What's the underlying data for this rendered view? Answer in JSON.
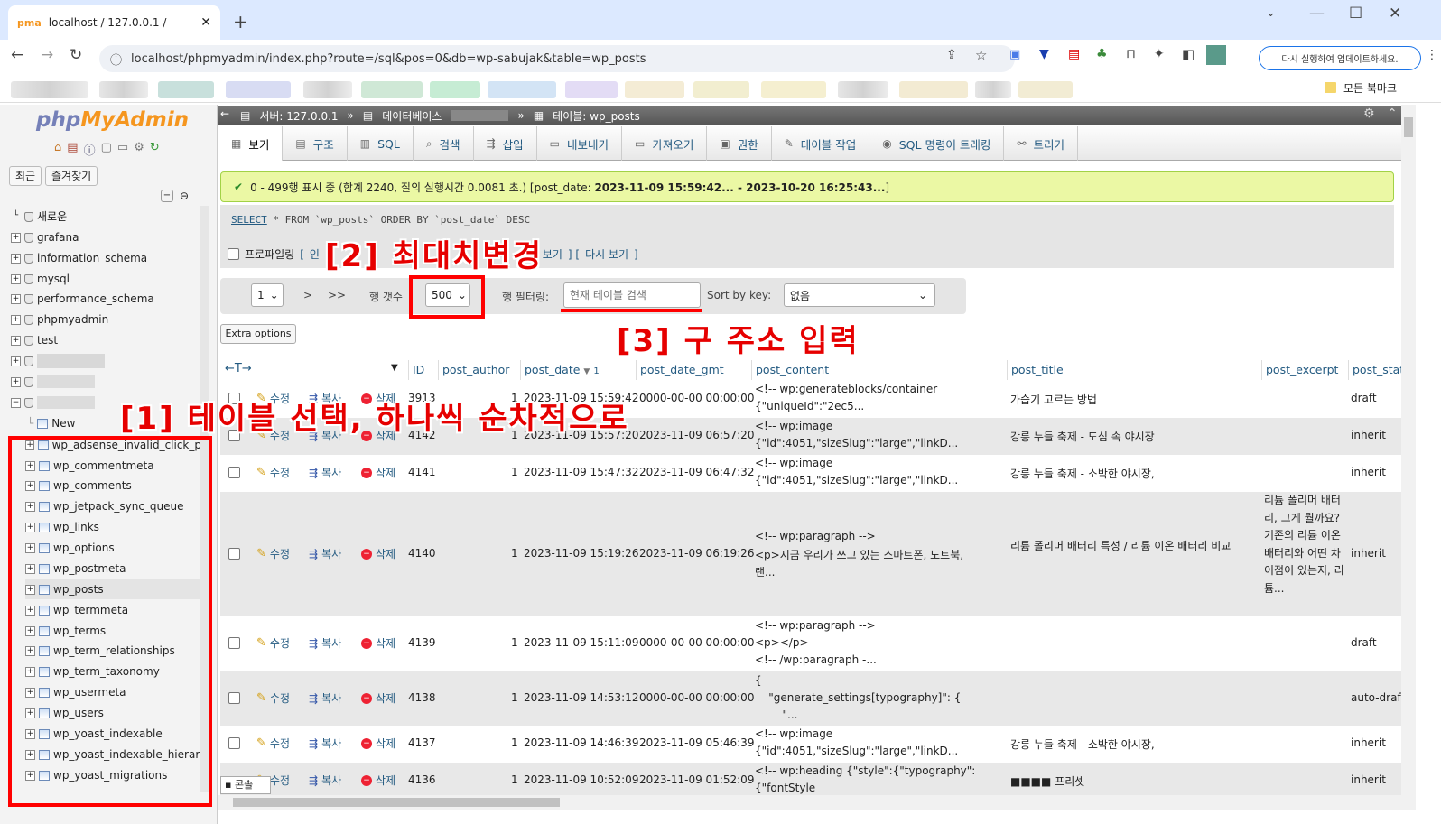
{
  "browser": {
    "tab_title": "localhost / 127.0.0.1 /",
    "url": "localhost/phpmyadmin/index.php?route=/sql&pos=0&db=wp-sabujak&table=wp_posts",
    "update_button": "다시 실행하여 업데이트하세요.",
    "bookmarks_label": "모든 북마크"
  },
  "sidebar": {
    "logo_main": "php",
    "logo_accent": "MyAdmin",
    "recent_label": "최근",
    "favorites_label": "즐겨찾기",
    "new_label": "새로운",
    "databases": [
      "grafana",
      "information_schema",
      "mysql",
      "performance_schema",
      "phpmyadmin",
      "test"
    ],
    "new_table_label": "New",
    "tables": [
      "wp_adsense_invalid_click_p",
      "wp_commentmeta",
      "wp_comments",
      "wp_jetpack_sync_queue",
      "wp_links",
      "wp_options",
      "wp_postmeta",
      "wp_posts",
      "wp_termmeta",
      "wp_terms",
      "wp_term_relationships",
      "wp_term_taxonomy",
      "wp_usermeta",
      "wp_users",
      "wp_yoast_indexable",
      "wp_yoast_indexable_hierar",
      "wp_yoast_migrations"
    ]
  },
  "breadcrumb": {
    "server": "서버: 127.0.0.1",
    "database": "데이터베이스",
    "table": "테이블: wp_posts"
  },
  "tabs": [
    "보기",
    "구조",
    "SQL",
    "검색",
    "삽입",
    "내보내기",
    "가져오기",
    "권한",
    "테이블 작업",
    "SQL 명령어 트래킹",
    "트리거"
  ],
  "success_msg": "0 - 499행 표시 중 (합계 2240, 질의 실행시간 0.0081 초.) [post_date: ",
  "success_range": "2023-11-09 15:59:42... - 2023-10-20 16:25:43...",
  "success_end": "]",
  "sql": {
    "select": "SELECT",
    "rest": "* FROM `wp_posts` ORDER BY `post_date` DESC"
  },
  "profiling": {
    "label": "프로파일링",
    "open": "[",
    "edit_fragment": "인",
    "code_fragment": "드 보기",
    "sep": "] [",
    "refresh": "다시 보기",
    "close": "]"
  },
  "nav": {
    "page": "1",
    "next": ">",
    "last": ">>",
    "rows_label": "행 갯수",
    "rows_value": "500",
    "filter_label": "행 필터링:",
    "filter_placeholder": "현재 테이블 검색",
    "sort_label": "Sort by key:",
    "sort_value": "없음"
  },
  "extra_options": "Extra options",
  "columns": {
    "arrows": "←T→",
    "id": "ID",
    "post_author": "post_author",
    "post_date": "post_date",
    "post_date_sort": "1",
    "post_date_gmt": "post_date_gmt",
    "post_content": "post_content",
    "post_title": "post_title",
    "post_excerpt": "post_excerpt",
    "post_status": "post_stat"
  },
  "row_actions": {
    "edit": "수정",
    "copy": "복사",
    "delete": "삭제"
  },
  "rows": [
    {
      "id": "3913",
      "author": "1",
      "date": "2023-11-09 15:59:42",
      "gmt": "0000-00-00 00:00:00",
      "content1": "<!-- wp:generateblocks/container",
      "content2": "{\"uniqueId\":\"2ec5...",
      "content3": "",
      "title": "가습기 고르는 방법",
      "excerpt": "",
      "status": "draft"
    },
    {
      "id": "4142",
      "author": "1",
      "date": "2023-11-09 15:57:20",
      "gmt": "2023-11-09 06:57:20",
      "content1": "<!-- wp:image",
      "content2": "{\"id\":4051,\"sizeSlug\":\"large\",\"linkD...",
      "content3": "",
      "title": "강릉 누들 축제 - 도심 속 야시장",
      "excerpt": "",
      "status": "inherit"
    },
    {
      "id": "4141",
      "author": "1",
      "date": "2023-11-09 15:47:32",
      "gmt": "2023-11-09 06:47:32",
      "content1": "<!-- wp:image",
      "content2": "{\"id\":4051,\"sizeSlug\":\"large\",\"linkD...",
      "content3": "",
      "title": "강릉 누들 축제 - 소박한 야시장,",
      "excerpt": "",
      "status": "inherit"
    },
    {
      "id": "4140",
      "author": "1",
      "date": "2023-11-09 15:19:26",
      "gmt": "2023-11-09 06:19:26",
      "content1": "<!-- wp:paragraph -->",
      "content2": "<p>지금 우리가 쓰고 있는 스마트폰, 노트북,",
      "content3": "랜...",
      "title": "리튬 폴리머 배터리 특성 / 리튬 이온 배터리 비교",
      "excerpt": "리튬 폴리머 배터리, 그게 뭘까요? 기존의 리튬 이온 배터리와 어떤 차이점이 있는지, 리튬...",
      "status": "inherit"
    },
    {
      "id": "4139",
      "author": "1",
      "date": "2023-11-09 15:11:09",
      "gmt": "0000-00-00 00:00:00",
      "content1": "<!-- wp:paragraph -->",
      "content2": "<p></p>",
      "content3": "<!-- /wp:paragraph -...",
      "title": "",
      "excerpt": "",
      "status": "draft"
    },
    {
      "id": "4138",
      "author": "1",
      "date": "2023-11-09 14:53:12",
      "gmt": "0000-00-00 00:00:00",
      "content1": "{",
      "content2": "    \"generate_settings[typography]\": {",
      "content3": "        \"...",
      "title": "",
      "excerpt": "",
      "status": "auto-draf"
    },
    {
      "id": "4137",
      "author": "1",
      "date": "2023-11-09 14:46:39",
      "gmt": "2023-11-09 05:46:39",
      "content1": "<!-- wp:image",
      "content2": "{\"id\":4051,\"sizeSlug\":\"large\",\"linkD...",
      "content3": "",
      "title": "강릉 누들 축제 - 소박한 야시장,",
      "excerpt": "",
      "status": "inherit"
    },
    {
      "id": "4136",
      "author": "1",
      "date": "2023-11-09 10:52:09",
      "gmt": "2023-11-09 01:52:09",
      "content1": "<!-- wp:heading {\"style\":{\"typography\":",
      "content2": "{\"fontStyle",
      "content3": "",
      "title": "■■■■ 프리셋",
      "excerpt": "",
      "status": "inherit"
    }
  ],
  "console_label": "콘솔",
  "annotations": {
    "a1": "[1] 테이블 선택, 하나씩 순차적으로",
    "a2": "[2] 최대치변경",
    "a3": "[3] 구 주소 입력"
  },
  "colors": {
    "annotation": "#ff0000",
    "success_bg": "#ebf8a4",
    "link": "#235a81"
  }
}
